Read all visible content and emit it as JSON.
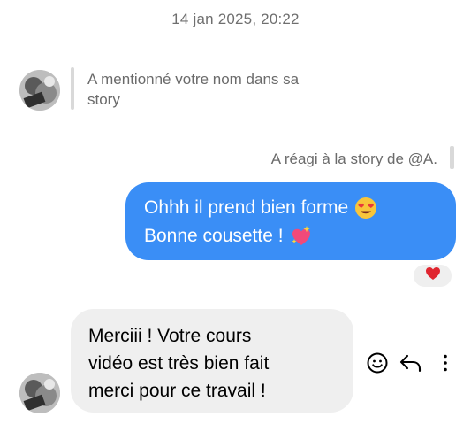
{
  "conversation": {
    "timestamp": "14 jan 2025, 20:22"
  },
  "messages": [
    {
      "direction": "incoming",
      "type": "story_mention",
      "text_lines": [
        "A mentionné votre nom dans sa",
        "story"
      ]
    },
    {
      "direction": "outgoing",
      "reply_context": "A réagi à la story de @A.",
      "text_lines": [
        "Ohhh il prend bien forme",
        "Bonne cousette !"
      ],
      "emojis": [
        "heart-eyes-emoji",
        "sparkling-heart-emoji"
      ],
      "reaction": "red-heart-emoji"
    },
    {
      "direction": "incoming",
      "type": "text",
      "text_lines": [
        "Merciii ! Votre cours",
        "vidéo est très bien fait",
        "merci pour ce travail !"
      ]
    }
  ],
  "message_actions": [
    {
      "icon": "smiley-icon",
      "label": "React"
    },
    {
      "icon": "reply-icon",
      "label": "Reply"
    },
    {
      "icon": "more-vertical-icon",
      "label": "More"
    }
  ],
  "colors": {
    "outgoing_bubble": "#3a8ef6",
    "incoming_bubble": "#efefef",
    "secondary_text": "#6b6b6b"
  }
}
